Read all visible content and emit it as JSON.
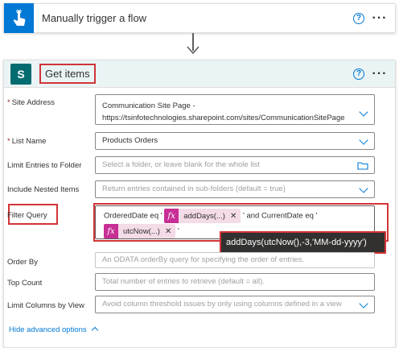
{
  "trigger": {
    "title": "Manually trigger a flow",
    "help": "?",
    "more": "···"
  },
  "action": {
    "title": "Get items",
    "help": "?",
    "more": "···",
    "icon_letter": "S"
  },
  "fields": {
    "site_address": {
      "label": "Site Address",
      "required": "*",
      "value_line1": "Communication Site Page -",
      "value_line2": "https://tsinfotechnologies.sharepoint.com/sites/CommunicationSitePage"
    },
    "list_name": {
      "label": "List Name",
      "required": "*",
      "value": "Products Orders"
    },
    "limit_folder": {
      "label": "Limit Entries to Folder",
      "placeholder": "Select a folder, or leave blank for the whole list"
    },
    "nested_items": {
      "label": "Include Nested Items",
      "placeholder": "Return entries contained in sub-folders (default = true)"
    },
    "filter_query": {
      "label": "Filter Query",
      "text1": "OrderedDate eq '",
      "token1": "addDays(...)",
      "text2": "' and CurrentDate eq '",
      "token2": "utcNow(...)",
      "text3": "'"
    },
    "order_by": {
      "label": "Order By",
      "placeholder": "An ODATA orderBy query for specifying the order of entries."
    },
    "top_count": {
      "label": "Top Count",
      "placeholder": "Total number of entries to retrieve (default = all)."
    },
    "limit_columns": {
      "label": "Limit Columns by View",
      "placeholder": "Avoid column threshold issues by only using columns defined in a view"
    }
  },
  "tooltip": "addDays(utcNow(),-3,'MM-dd-yyyy')",
  "advanced_link": "Hide advanced options",
  "colors": {
    "accent": "#0078d4",
    "highlight": "#d13438",
    "sharepoint": "#036c70",
    "expression_token": "#c72f95"
  }
}
